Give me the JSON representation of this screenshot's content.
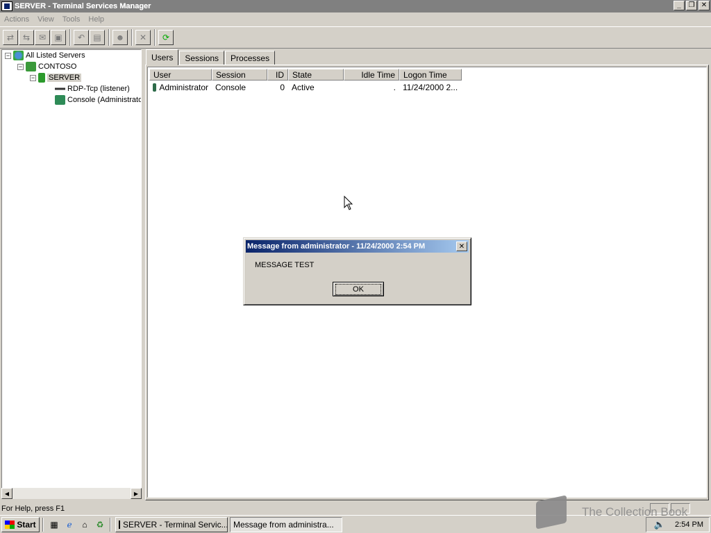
{
  "window": {
    "title": "SERVER - Terminal Services Manager",
    "controls": {
      "minimize": "_",
      "restore": "❐",
      "close": "✕"
    }
  },
  "menu": [
    "Actions",
    "View",
    "Tools",
    "Help"
  ],
  "toolbar": {
    "icons": [
      "connect-icon",
      "disconnect-icon",
      "send-message-icon",
      "remote-control-icon",
      "reset-icon",
      "status-icon",
      "logoff-icon",
      "end-process-icon",
      "refresh-icon"
    ]
  },
  "tree": {
    "all_servers": "All Listed Servers",
    "domain": "CONTOSO",
    "server": "SERVER",
    "listener": "RDP-Tcp (listener)",
    "console": "Console (Administrato"
  },
  "tabs": [
    "Users",
    "Sessions",
    "Processes"
  ],
  "table": {
    "columns": [
      "User",
      "Session",
      "ID",
      "State",
      "Idle Time",
      "Logon Time"
    ],
    "rows": [
      {
        "user": "Administrator",
        "session": "Console",
        "id": "0",
        "state": "Active",
        "idle": ".",
        "logon": "11/24/2000 2..."
      }
    ]
  },
  "dialog": {
    "title": "Message from administrator - 11/24/2000 2:54 PM",
    "message": "MESSAGE TEST",
    "ok_label": "OK"
  },
  "statusbar": {
    "text": "For Help, press F1"
  },
  "taskbar": {
    "start_label": "Start",
    "tasks": [
      "SERVER - Terminal Servic...",
      "Message from administra..."
    ],
    "clock": "2:54 PM"
  },
  "watermark": "The Collection Book",
  "colors": {
    "dialog_title_start": "#0a246a",
    "dialog_title_end": "#a6caf0",
    "face": "#d4d0c8"
  }
}
